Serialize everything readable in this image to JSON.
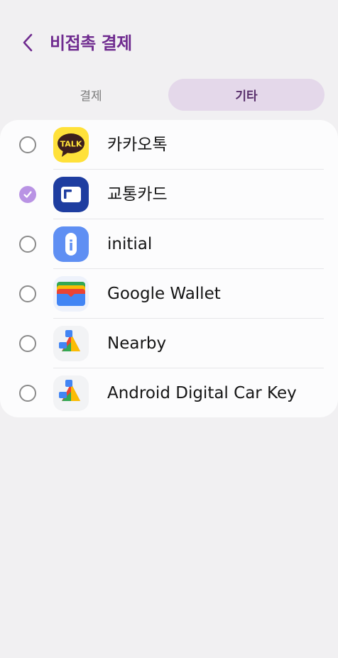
{
  "colors": {
    "accent": "#6f2b8f",
    "tab_active_bg": "#e4d8ea",
    "tab_active_text": "#59306c",
    "tab_inactive_text": "#7c7c7c",
    "radio_checked": "#b993e4"
  },
  "header": {
    "back_icon": "chevron-left-icon",
    "title": "비접촉 결제"
  },
  "tabs": [
    {
      "label": "결제",
      "active": false
    },
    {
      "label": "기타",
      "active": true
    }
  ],
  "apps": [
    {
      "label": "카카오톡",
      "selected": false,
      "icon": "kakaotalk-icon",
      "icon_text": "TALK"
    },
    {
      "label": "교통카드",
      "selected": true,
      "icon": "transit-card-icon"
    },
    {
      "label": "initial",
      "selected": false,
      "icon": "info-icon",
      "icon_text": "i"
    },
    {
      "label": "Google Wallet",
      "selected": false,
      "icon": "google-wallet-icon"
    },
    {
      "label": "Nearby",
      "selected": false,
      "icon": "play-services-icon"
    },
    {
      "label": "Android Digital Car Key",
      "selected": false,
      "icon": "play-services-icon"
    }
  ]
}
